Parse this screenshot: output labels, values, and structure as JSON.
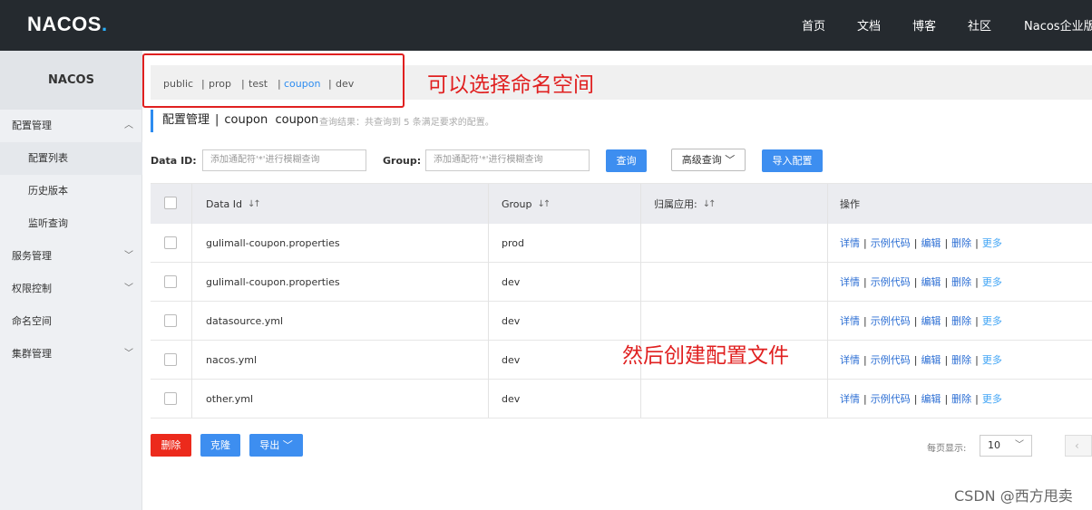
{
  "header": {
    "logo_main": "NACOS",
    "logo_dot": ".",
    "nav": [
      "首页",
      "文档",
      "博客",
      "社区",
      "Nacos企业版"
    ]
  },
  "sidebar": {
    "title": "NACOS",
    "items": [
      {
        "label": "配置管理",
        "type": "group",
        "expanded": true
      },
      {
        "label": "配置列表",
        "type": "sub",
        "active": true
      },
      {
        "label": "历史版本",
        "type": "sub"
      },
      {
        "label": "监听查询",
        "type": "sub"
      },
      {
        "label": "服务管理",
        "type": "group"
      },
      {
        "label": "权限控制",
        "type": "group"
      },
      {
        "label": "命名空间",
        "type": "plain"
      },
      {
        "label": "集群管理",
        "type": "group"
      }
    ]
  },
  "namespaces": [
    {
      "label": "public",
      "active": false
    },
    {
      "label": "prop",
      "active": false
    },
    {
      "label": "test",
      "active": false
    },
    {
      "label": "coupon",
      "active": true
    },
    {
      "label": "dev",
      "active": false
    }
  ],
  "annotations": {
    "namespace_note": "可以选择命名空间",
    "create_note": "然后创建配置文件"
  },
  "breadcrumb": {
    "section": "配置管理",
    "separator": "|",
    "namespace": "coupon",
    "namespace_id": "coupon"
  },
  "query_result": "查询结果：共查询到 5 条满足要求的配置。",
  "filters": {
    "data_id_label": "Data ID:",
    "data_id_placeholder": "添加通配符'*'进行模糊查询",
    "group_label": "Group:",
    "group_placeholder": "添加通配符'*'进行模糊查询",
    "query_button": "查询",
    "advanced_button": "高级查询",
    "import_button": "导入配置"
  },
  "table": {
    "columns": [
      "Data Id",
      "Group",
      "归属应用:",
      "操作"
    ],
    "rows": [
      {
        "data_id": "gulimall-coupon.properties",
        "group": "prod",
        "app": ""
      },
      {
        "data_id": "gulimall-coupon.properties",
        "group": "dev",
        "app": ""
      },
      {
        "data_id": "datasource.yml",
        "group": "dev",
        "app": ""
      },
      {
        "data_id": "nacos.yml",
        "group": "dev",
        "app": ""
      },
      {
        "data_id": "other.yml",
        "group": "dev",
        "app": ""
      }
    ],
    "actions": [
      "详情",
      "示例代码",
      "编辑",
      "删除",
      "更多"
    ],
    "action_separator": "|"
  },
  "footer": {
    "delete_button": "删除",
    "clone_button": "克隆",
    "export_button": "导出",
    "per_page_label": "每页显示:",
    "per_page_value": "10"
  },
  "watermark": "CSDN @西方甩卖",
  "colors": {
    "topbar": "#252a2f",
    "primary": "#3d8ef0",
    "danger": "#ec2a1c",
    "annotation": "#e02020"
  },
  "icons": {
    "sort": "sort-arrows-icon",
    "chevron": "chevron-down-icon"
  }
}
